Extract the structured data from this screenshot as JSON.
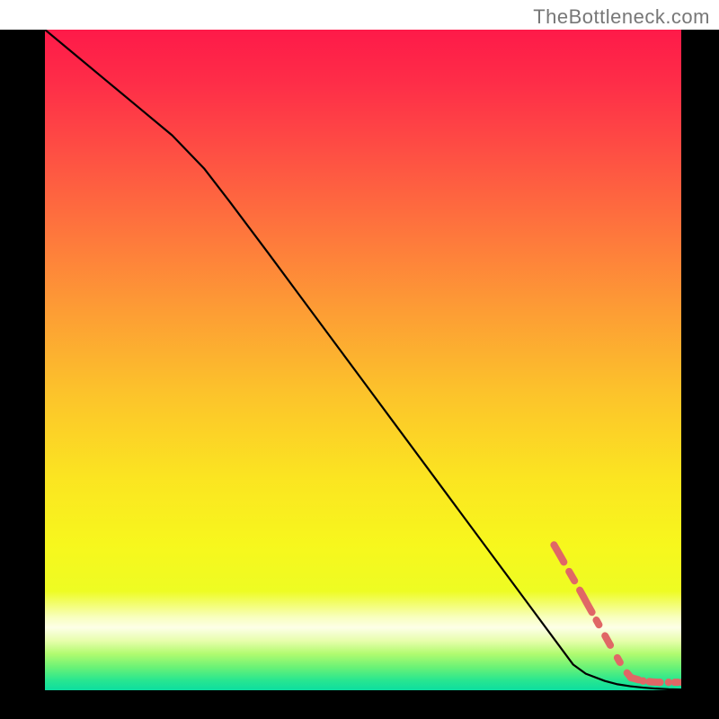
{
  "watermark": "TheBottleneck.com",
  "chart_data": {
    "type": "line",
    "title": "",
    "xlabel": "",
    "ylabel": "",
    "xlim": [
      0,
      100
    ],
    "ylim": [
      0,
      100
    ],
    "grid": false,
    "legend": false,
    "series": [
      {
        "name": "curve",
        "style": "solid-black",
        "x": [
          0,
          5,
          10,
          15,
          20,
          25,
          29,
          35,
          40,
          45,
          50,
          55,
          60,
          65,
          70,
          75,
          80,
          83,
          85,
          88,
          90,
          92,
          94,
          96,
          98,
          100
        ],
        "y": [
          100,
          96,
          92,
          88,
          84,
          79,
          74,
          66.3,
          59.8,
          53.3,
          46.8,
          40.3,
          33.8,
          27.3,
          20.8,
          14.3,
          7.8,
          3.9,
          2.5,
          1.4,
          0.9,
          0.6,
          0.4,
          0.25,
          0.15,
          0.1
        ]
      },
      {
        "name": "dot-segment",
        "style": "thick-dashed-salmon",
        "points": [
          {
            "x": 80.0,
            "y": 22.0
          },
          {
            "x": 81.2,
            "y": 20.0
          },
          {
            "x": 82.3,
            "y": 18.1
          },
          {
            "x": 83.5,
            "y": 16.1
          },
          {
            "x": 84.6,
            "y": 14.2
          },
          {
            "x": 85.1,
            "y": 13.3
          },
          {
            "x": 86.2,
            "y": 11.4
          },
          {
            "x": 87.3,
            "y": 9.5
          },
          {
            "x": 88.4,
            "y": 7.6
          },
          {
            "x": 89.5,
            "y": 5.7
          },
          {
            "x": 90.5,
            "y": 4.0
          },
          {
            "x": 91.5,
            "y": 2.6
          },
          {
            "x": 92.1,
            "y": 1.9
          },
          {
            "x": 94.0,
            "y": 1.4
          },
          {
            "x": 95.0,
            "y": 1.3
          },
          {
            "x": 96.6,
            "y": 1.2
          },
          {
            "x": 98.0,
            "y": 1.2
          },
          {
            "x": 100.2,
            "y": 1.2
          }
        ]
      }
    ],
    "background_gradient": {
      "type": "vertical",
      "stops": [
        {
          "pos": 0.0,
          "color": "#fe1a49"
        },
        {
          "pos": 0.08,
          "color": "#fe2d48"
        },
        {
          "pos": 0.18,
          "color": "#fe4d44"
        },
        {
          "pos": 0.3,
          "color": "#fe743d"
        },
        {
          "pos": 0.42,
          "color": "#fd9b35"
        },
        {
          "pos": 0.55,
          "color": "#fcc32b"
        },
        {
          "pos": 0.68,
          "color": "#fbe521"
        },
        {
          "pos": 0.78,
          "color": "#f7f71d"
        },
        {
          "pos": 0.85,
          "color": "#eefc23"
        },
        {
          "pos": 0.89,
          "color": "#f8ffc0"
        },
        {
          "pos": 0.905,
          "color": "#fdffe7"
        },
        {
          "pos": 0.925,
          "color": "#e7fead"
        },
        {
          "pos": 0.945,
          "color": "#b1fb6f"
        },
        {
          "pos": 0.965,
          "color": "#6bf276"
        },
        {
          "pos": 0.985,
          "color": "#28e690"
        },
        {
          "pos": 1.0,
          "color": "#0cdea0"
        }
      ]
    }
  }
}
